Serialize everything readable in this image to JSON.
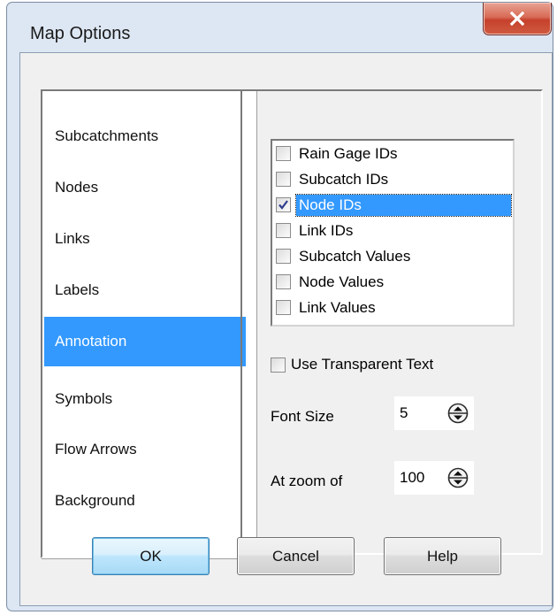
{
  "window": {
    "title": "Map Options"
  },
  "nav": {
    "items": [
      {
        "label": "Subcatchments"
      },
      {
        "label": "Nodes"
      },
      {
        "label": "Links"
      },
      {
        "label": "Labels"
      },
      {
        "label": "Annotation",
        "selected": true
      },
      {
        "label": "Symbols"
      },
      {
        "label": "Flow Arrows"
      },
      {
        "label": "Background"
      }
    ]
  },
  "annotation": {
    "checklist": [
      {
        "label": "Rain Gage IDs",
        "checked": false
      },
      {
        "label": "Subcatch IDs",
        "checked": false
      },
      {
        "label": "Node IDs",
        "checked": true,
        "focused": true
      },
      {
        "label": "Link IDs",
        "checked": false
      },
      {
        "label": "Subcatch Values",
        "checked": false
      },
      {
        "label": "Node Values",
        "checked": false
      },
      {
        "label": "Link Values",
        "checked": false
      }
    ],
    "transparent_text": {
      "label": "Use Transparent Text",
      "checked": false
    },
    "font_size": {
      "label": "Font Size",
      "value": "5"
    },
    "zoom": {
      "label": "At zoom of",
      "value": "100"
    }
  },
  "buttons": {
    "ok": "OK",
    "cancel": "Cancel",
    "help": "Help"
  },
  "colors": {
    "selection": "#3399ff",
    "dialog_face": "#f0f0f0",
    "close_button": "#c6412c"
  },
  "icons": {
    "close": "close-x-icon",
    "spin": "spin-updown-icon",
    "check": "checkmark-icon"
  }
}
